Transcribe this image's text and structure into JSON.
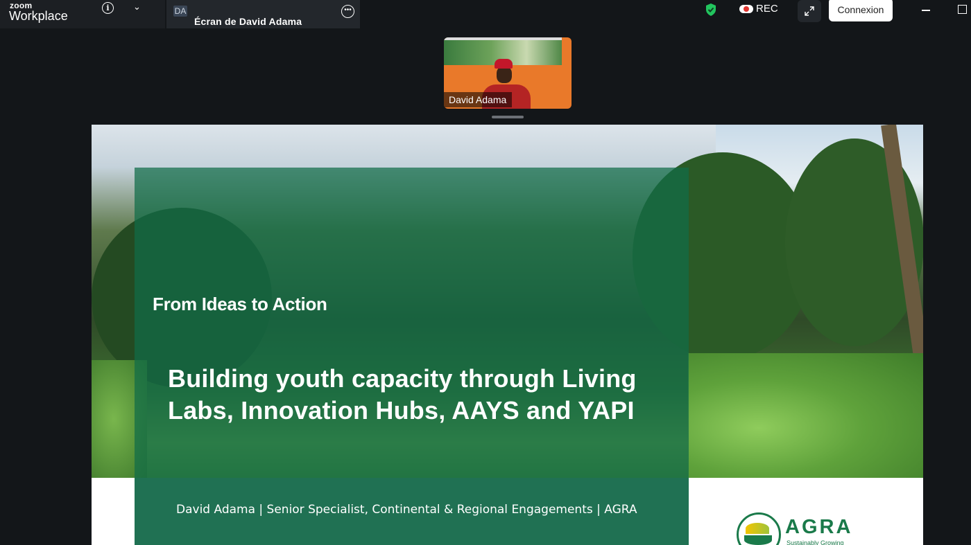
{
  "app": {
    "brand_line1": "zoom",
    "brand_line2": "Workplace",
    "info_icon": "info-icon",
    "dropdown_icon": "chevron-down-icon"
  },
  "share_tab": {
    "initials": "DA",
    "title": "Écran de David Adama",
    "more_icon": "more-options-icon"
  },
  "toolbar": {
    "security_icon": "shield-check-icon",
    "rec_label": "REC",
    "expand_icon": "expand-icon",
    "connexion_label": "Connexion",
    "accent_color": "#22c55e"
  },
  "window_controls": {
    "minimize_icon": "minimize-icon",
    "maximize_icon": "maximize-icon"
  },
  "participant": {
    "name": "David Adama"
  },
  "slide": {
    "subtitle": "From Ideas to Action",
    "title": "Building youth capacity through Living Labs, Innovation Hubs, AAYS and YAPI",
    "byline": "David Adama | Senior Specialist, Continental & Regional Engagements | AGRA",
    "logo_word": "AGRA",
    "logo_tagline": "Sustainably Growing",
    "panel_color": "#106c48"
  }
}
